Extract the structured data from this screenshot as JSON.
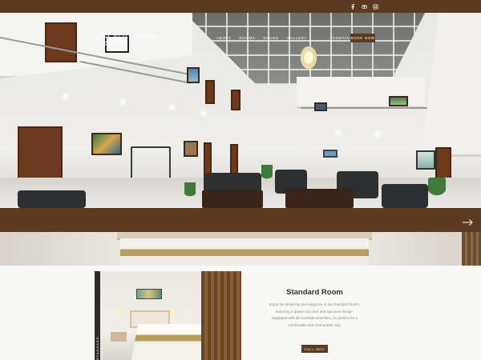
{
  "header": {
    "logo": {
      "name": "WE ELANIS HOTEL",
      "sub_name": "維 楽 酒 店"
    },
    "nav": [
      {
        "label": "ABOUT"
      },
      {
        "label": "ROOMS"
      },
      {
        "label": "DINING"
      },
      {
        "label": "GALLERY"
      },
      {
        "label": "CONTACT"
      }
    ],
    "book_now_label": "BOOK NOW",
    "social_icons": [
      "facebook-icon",
      "tripadvisor-icon",
      "instagram-icon"
    ]
  },
  "hero": {
    "next_arrow_icon": "arrow-right-icon"
  },
  "room": {
    "title": "Standard Room",
    "description_lines": [
      "Enjoy the simplicity and elegance of our Standard Room,",
      "featuring a queen-size bed and spacious design.",
      "Equipped with all essential amenities, it's perfect for a",
      "comfortable and memorable stay."
    ],
    "side_label": "STANDARD ROOM",
    "full_info_label": "FULL INFO"
  },
  "colors": {
    "brand_brown": "#5a3a20",
    "text_dark": "#333333",
    "text_muted": "#8a8a88",
    "white": "#ffffff"
  }
}
